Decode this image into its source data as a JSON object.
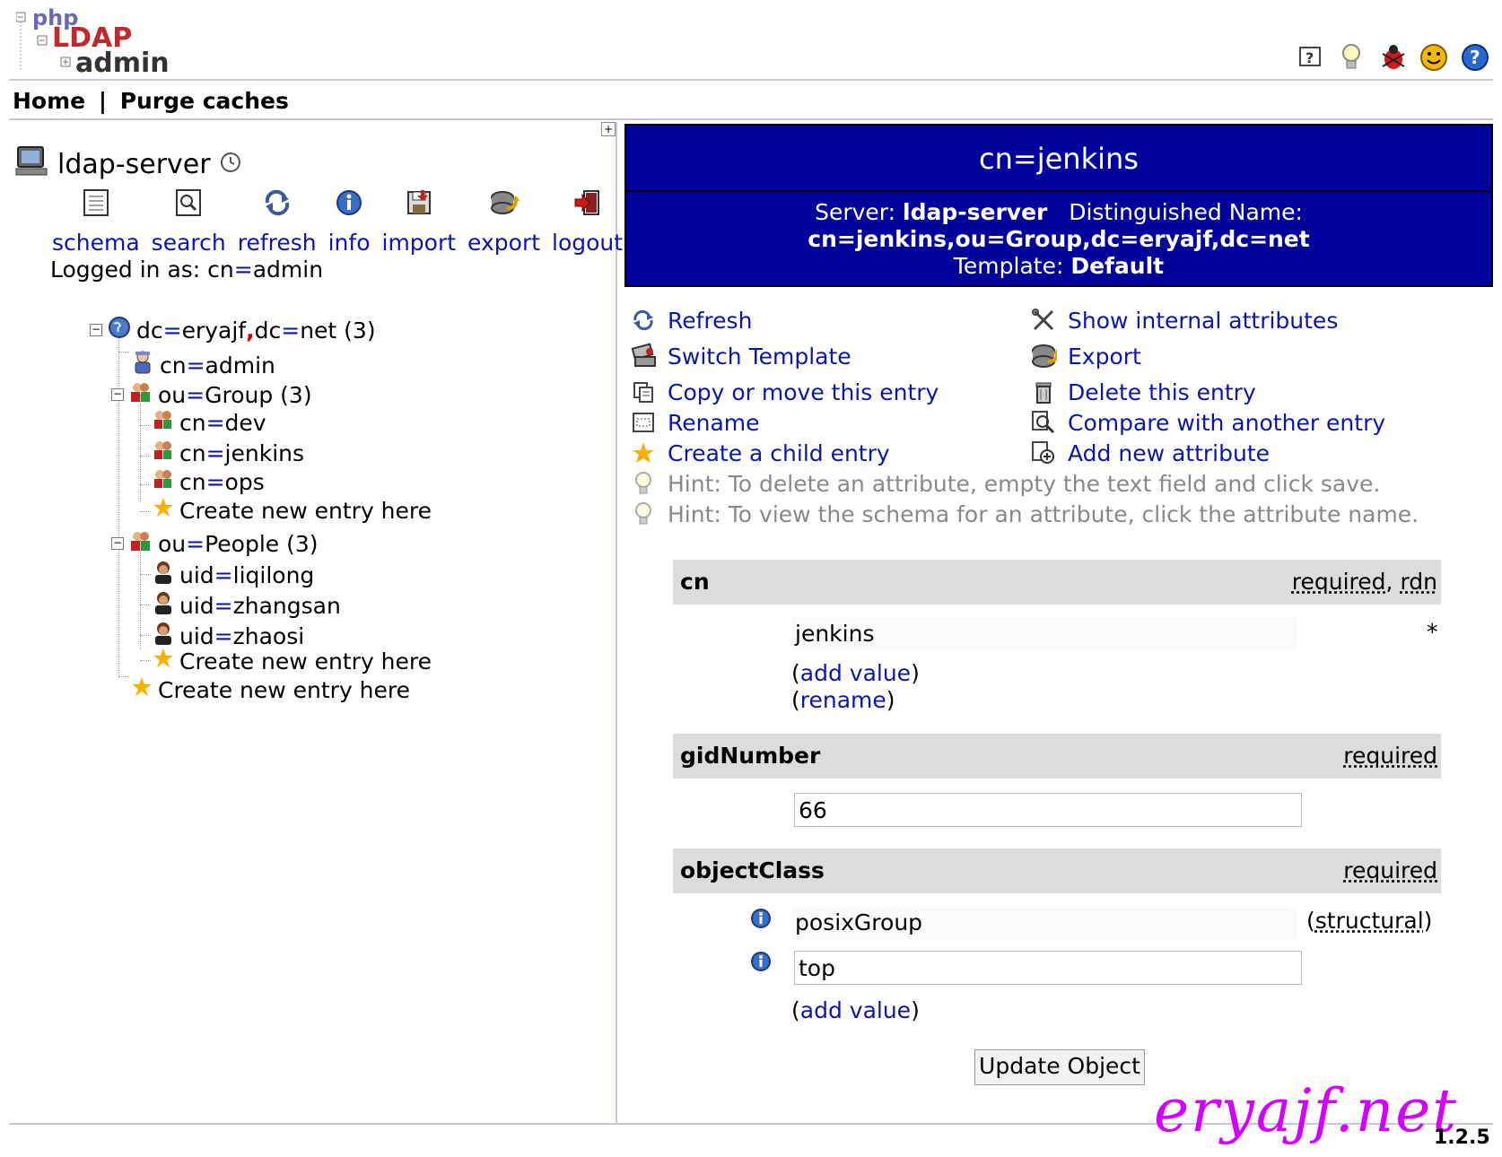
{
  "logo": {
    "php": "php",
    "ldap": "LDAP",
    "admin": "admin"
  },
  "top_icons": [
    "help-icon",
    "lightbulb-icon",
    "bug-icon",
    "smiley-icon",
    "support-icon"
  ],
  "menu": {
    "home": "Home",
    "separator": "|",
    "purge": "Purge caches"
  },
  "server": {
    "name": "ldap-server",
    "clock_icon": "clock-icon"
  },
  "server_actions": [
    {
      "label": "schema",
      "icon": "schema-icon"
    },
    {
      "label": "search",
      "icon": "search-icon"
    },
    {
      "label": "refresh",
      "icon": "refresh-icon"
    },
    {
      "label": "info",
      "icon": "info-icon"
    },
    {
      "label": "import",
      "icon": "import-icon"
    },
    {
      "label": "export",
      "icon": "export-icon"
    },
    {
      "label": "logout",
      "icon": "logout-icon"
    }
  ],
  "logged_in": {
    "prefix": "Logged in as: ",
    "user_a": "cn",
    "eq": "=",
    "user_b": "admin"
  },
  "tree": {
    "root": {
      "a": "dc",
      "b": "eryajf",
      "comma": ",",
      "c": "dc",
      "d": "net",
      "count": "(3)"
    },
    "admin": {
      "a": "cn",
      "b": "admin"
    },
    "group": {
      "a": "ou",
      "b": "Group",
      "count": "(3)"
    },
    "dev": {
      "a": "cn",
      "b": "dev"
    },
    "jenkins": {
      "a": "cn",
      "b": "jenkins"
    },
    "ops": {
      "a": "cn",
      "b": "ops"
    },
    "people": {
      "a": "ou",
      "b": "People",
      "count": "(3)"
    },
    "liqilong": {
      "a": "uid",
      "b": "liqilong"
    },
    "zhangsan": {
      "a": "uid",
      "b": "zhangsan"
    },
    "zhaosi": {
      "a": "uid",
      "b": "zhaosi"
    },
    "create": "Create new entry here"
  },
  "banner": {
    "title": "cn=jenkins",
    "server_label": "Server:",
    "server_value": "ldap-server",
    "dn_label": "Distinguished Name:",
    "dn_value": "cn=jenkins,ou=Group,dc=eryajf,dc=net",
    "template_label": "Template:",
    "template_value": "Default"
  },
  "actions": {
    "refresh": "Refresh",
    "show_internal": "Show internal attributes",
    "switch_template": "Switch Template",
    "export": "Export",
    "copy_move": "Copy or move this entry",
    "delete": "Delete this entry",
    "rename": "Rename",
    "compare": "Compare with another entry",
    "create_child": "Create a child entry",
    "add_attribute": "Add new attribute",
    "hint1": "Hint: To delete an attribute, empty the text field and click save.",
    "hint2": "Hint: To view the schema for an attribute, click the attribute name."
  },
  "attributes": {
    "cn": {
      "name": "cn",
      "required": "required",
      "comma": ", ",
      "rdn": "rdn",
      "value": "jenkins",
      "asterisk": "*",
      "add_value": "add value",
      "rename": "rename",
      "open": "(",
      "close": ")"
    },
    "gid": {
      "name": "gidNumber",
      "required": "required",
      "value": "66"
    },
    "oc": {
      "name": "objectClass",
      "required": "required",
      "value1": "posixGroup",
      "structural": "structural",
      "value2": "top",
      "add_value": "add value",
      "open": "(",
      "close": ")"
    }
  },
  "update_button": "Update Object",
  "watermark": "eryajf.net",
  "version": "1.2.5"
}
